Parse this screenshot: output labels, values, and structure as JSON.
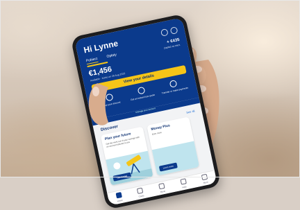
{
  "app": {
    "greeting": "Hi Lynne",
    "tabs": [
      "Pobierz",
      "Opłaty"
    ],
    "side_amount": "+ €435",
    "side_sub": "Zapłać za mies.",
    "balance": "€1,456",
    "balance_sub": "Available · konto on 28 Aug 2023",
    "cta_label": "View your details",
    "actions": [
      "Top up your account",
      "Get an instant loan quote",
      "Transfer or make payments"
    ],
    "manage_text": "Manage your account",
    "discover_title": "Discover",
    "see_all": "See all",
    "cards": [
      {
        "title": "Plan your future",
        "text": "Get the most out of your savings with an account tailored to you",
        "button": "Get started"
      },
      {
        "title": "Money Plus",
        "text": "Earn more",
        "button": "Learn more"
      }
    ],
    "nav": [
      "Home",
      "Cards",
      "Move",
      "Help",
      "More"
    ]
  },
  "colors": {
    "brand_blue": "#0b3a8c",
    "accent_yellow": "#f5c518"
  }
}
